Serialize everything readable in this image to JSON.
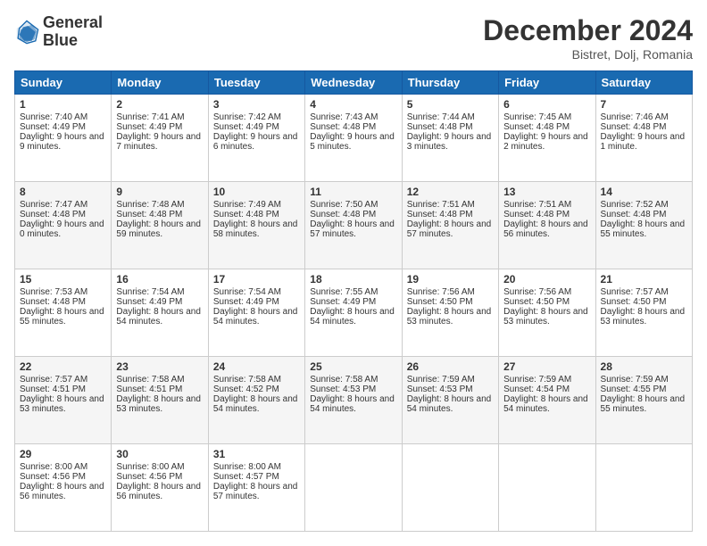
{
  "logo": {
    "line1": "General",
    "line2": "Blue"
  },
  "header": {
    "month": "December 2024",
    "location": "Bistret, Dolj, Romania"
  },
  "days": [
    "Sunday",
    "Monday",
    "Tuesday",
    "Wednesday",
    "Thursday",
    "Friday",
    "Saturday"
  ],
  "weeks": [
    [
      {
        "day": "1",
        "sunrise": "7:40 AM",
        "sunset": "4:49 PM",
        "daylight": "9 hours and 9 minutes."
      },
      {
        "day": "2",
        "sunrise": "7:41 AM",
        "sunset": "4:49 PM",
        "daylight": "9 hours and 7 minutes."
      },
      {
        "day": "3",
        "sunrise": "7:42 AM",
        "sunset": "4:49 PM",
        "daylight": "9 hours and 6 minutes."
      },
      {
        "day": "4",
        "sunrise": "7:43 AM",
        "sunset": "4:48 PM",
        "daylight": "9 hours and 5 minutes."
      },
      {
        "day": "5",
        "sunrise": "7:44 AM",
        "sunset": "4:48 PM",
        "daylight": "9 hours and 3 minutes."
      },
      {
        "day": "6",
        "sunrise": "7:45 AM",
        "sunset": "4:48 PM",
        "daylight": "9 hours and 2 minutes."
      },
      {
        "day": "7",
        "sunrise": "7:46 AM",
        "sunset": "4:48 PM",
        "daylight": "9 hours and 1 minute."
      }
    ],
    [
      {
        "day": "8",
        "sunrise": "7:47 AM",
        "sunset": "4:48 PM",
        "daylight": "9 hours and 0 minutes."
      },
      {
        "day": "9",
        "sunrise": "7:48 AM",
        "sunset": "4:48 PM",
        "daylight": "8 hours and 59 minutes."
      },
      {
        "day": "10",
        "sunrise": "7:49 AM",
        "sunset": "4:48 PM",
        "daylight": "8 hours and 58 minutes."
      },
      {
        "day": "11",
        "sunrise": "7:50 AM",
        "sunset": "4:48 PM",
        "daylight": "8 hours and 57 minutes."
      },
      {
        "day": "12",
        "sunrise": "7:51 AM",
        "sunset": "4:48 PM",
        "daylight": "8 hours and 57 minutes."
      },
      {
        "day": "13",
        "sunrise": "7:51 AM",
        "sunset": "4:48 PM",
        "daylight": "8 hours and 56 minutes."
      },
      {
        "day": "14",
        "sunrise": "7:52 AM",
        "sunset": "4:48 PM",
        "daylight": "8 hours and 55 minutes."
      }
    ],
    [
      {
        "day": "15",
        "sunrise": "7:53 AM",
        "sunset": "4:48 PM",
        "daylight": "8 hours and 55 minutes."
      },
      {
        "day": "16",
        "sunrise": "7:54 AM",
        "sunset": "4:49 PM",
        "daylight": "8 hours and 54 minutes."
      },
      {
        "day": "17",
        "sunrise": "7:54 AM",
        "sunset": "4:49 PM",
        "daylight": "8 hours and 54 minutes."
      },
      {
        "day": "18",
        "sunrise": "7:55 AM",
        "sunset": "4:49 PM",
        "daylight": "8 hours and 54 minutes."
      },
      {
        "day": "19",
        "sunrise": "7:56 AM",
        "sunset": "4:50 PM",
        "daylight": "8 hours and 53 minutes."
      },
      {
        "day": "20",
        "sunrise": "7:56 AM",
        "sunset": "4:50 PM",
        "daylight": "8 hours and 53 minutes."
      },
      {
        "day": "21",
        "sunrise": "7:57 AM",
        "sunset": "4:50 PM",
        "daylight": "8 hours and 53 minutes."
      }
    ],
    [
      {
        "day": "22",
        "sunrise": "7:57 AM",
        "sunset": "4:51 PM",
        "daylight": "8 hours and 53 minutes."
      },
      {
        "day": "23",
        "sunrise": "7:58 AM",
        "sunset": "4:51 PM",
        "daylight": "8 hours and 53 minutes."
      },
      {
        "day": "24",
        "sunrise": "7:58 AM",
        "sunset": "4:52 PM",
        "daylight": "8 hours and 54 minutes."
      },
      {
        "day": "25",
        "sunrise": "7:58 AM",
        "sunset": "4:53 PM",
        "daylight": "8 hours and 54 minutes."
      },
      {
        "day": "26",
        "sunrise": "7:59 AM",
        "sunset": "4:53 PM",
        "daylight": "8 hours and 54 minutes."
      },
      {
        "day": "27",
        "sunrise": "7:59 AM",
        "sunset": "4:54 PM",
        "daylight": "8 hours and 54 minutes."
      },
      {
        "day": "28",
        "sunrise": "7:59 AM",
        "sunset": "4:55 PM",
        "daylight": "8 hours and 55 minutes."
      }
    ],
    [
      {
        "day": "29",
        "sunrise": "8:00 AM",
        "sunset": "4:56 PM",
        "daylight": "8 hours and 56 minutes."
      },
      {
        "day": "30",
        "sunrise": "8:00 AM",
        "sunset": "4:56 PM",
        "daylight": "8 hours and 56 minutes."
      },
      {
        "day": "31",
        "sunrise": "8:00 AM",
        "sunset": "4:57 PM",
        "daylight": "8 hours and 57 minutes."
      },
      null,
      null,
      null,
      null
    ]
  ]
}
